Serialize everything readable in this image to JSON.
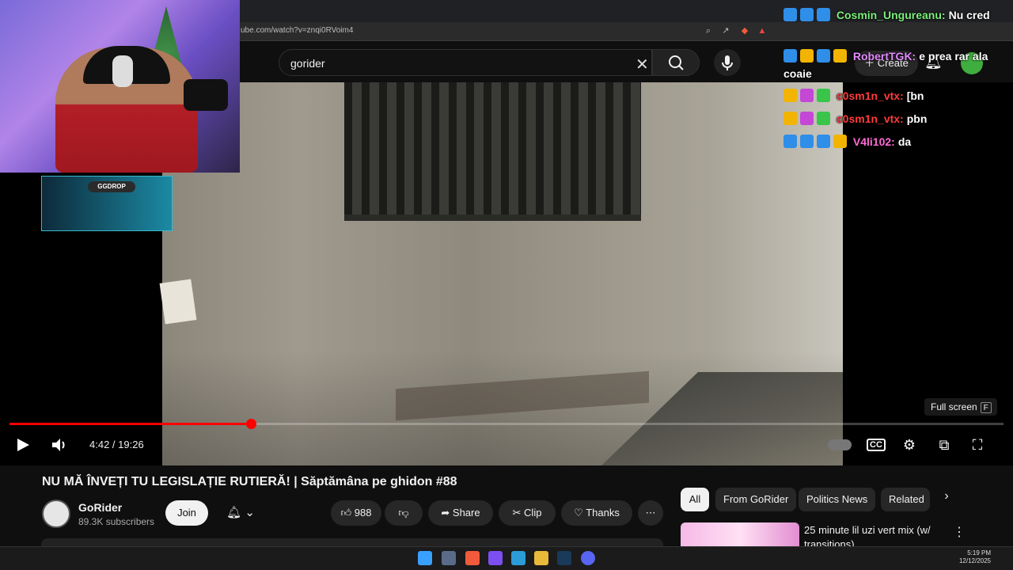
{
  "browser": {
    "url": "ube.com/watch?v=znqi0RVoim4"
  },
  "masthead": {
    "search_value": "gorider",
    "create_label": "Create"
  },
  "overlay": {
    "sponsor_label": "GGDROP"
  },
  "chat": {
    "messages": [
      {
        "user": "Cosmin_Ungureanu:",
        "text": "Nu cred",
        "user_color": "#7cf07c"
      },
      {
        "user": "RobertTGK:",
        "text": "e prea rar ala coaie",
        "user_color": "#e38bff"
      },
      {
        "user": "c0sm1n_vtx:",
        "text": "[bn",
        "user_color": "#ff3b3b"
      },
      {
        "user": "c0sm1n_vtx:",
        "text": "pbn",
        "user_color": "#ff3b3b"
      },
      {
        "user": "V4li102:",
        "text": "da",
        "user_color": "#ff6ad5"
      }
    ]
  },
  "player": {
    "time": "4:42 / 19:26",
    "progress_fraction": 0.2429,
    "fullscreen_tip": "Full screen",
    "fullscreen_key": "F"
  },
  "video": {
    "title": "NU MĂ ÎNVEȚI TU LEGISLAȚIE RUTIERĂ! | Săptămâna pe ghidon #88",
    "channel_name": "GoRider",
    "subscribers": "89.3K subscribers",
    "join_label": "Join",
    "likes": "988",
    "share_label": "Share",
    "clip_label": "Clip",
    "thanks_label": "Thanks"
  },
  "chips": [
    "All",
    "From GoRider",
    "Politics News",
    "Related"
  ],
  "recommendation": {
    "title": "25 minute lil uzi vert mix (w/ transitions)"
  },
  "taskbar": {
    "time": "5:19 PM",
    "date": "12/12/2025"
  },
  "colors": {
    "accent_red": "#ff0000",
    "chat_badge_blue": "#2f8ee8",
    "chat_badge_gold": "#f2b400",
    "chat_badge_green": "#38c54a"
  }
}
